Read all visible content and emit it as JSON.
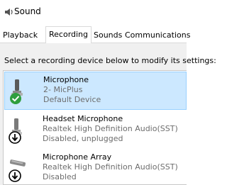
{
  "window": {
    "title": "Sound",
    "icon": "speaker-icon"
  },
  "tabs": [
    {
      "label": "Playback"
    },
    {
      "label": "Recording"
    },
    {
      "label": "Sounds"
    },
    {
      "label": "Communications"
    }
  ],
  "active_tab": "Recording",
  "instruction": "Select a recording device below to modify its settings:",
  "devices": [
    {
      "name": "Microphone",
      "line2": "2- MicPlus",
      "status": "Default Device",
      "status_icon": "check-icon",
      "device_icon": "microphone-icon",
      "selected": true
    },
    {
      "name": "Headset Microphone",
      "line2": "Realtek High Definition Audio(SST)",
      "status": "Disabled, unplugged",
      "status_icon": "down-arrow-icon",
      "device_icon": "microphone-icon",
      "selected": false
    },
    {
      "name": "Microphone Array",
      "line2": "Realtek High Definition Audio(SST)",
      "status": "Disabled",
      "status_icon": "down-arrow-icon",
      "device_icon": "microphone-array-icon",
      "selected": false
    }
  ],
  "colors": {
    "selection_bg": "#cce8ff",
    "selection_border": "#99d1ff",
    "default_badge": "#2e9e3e",
    "panel_bg": "#f0f0f0"
  }
}
